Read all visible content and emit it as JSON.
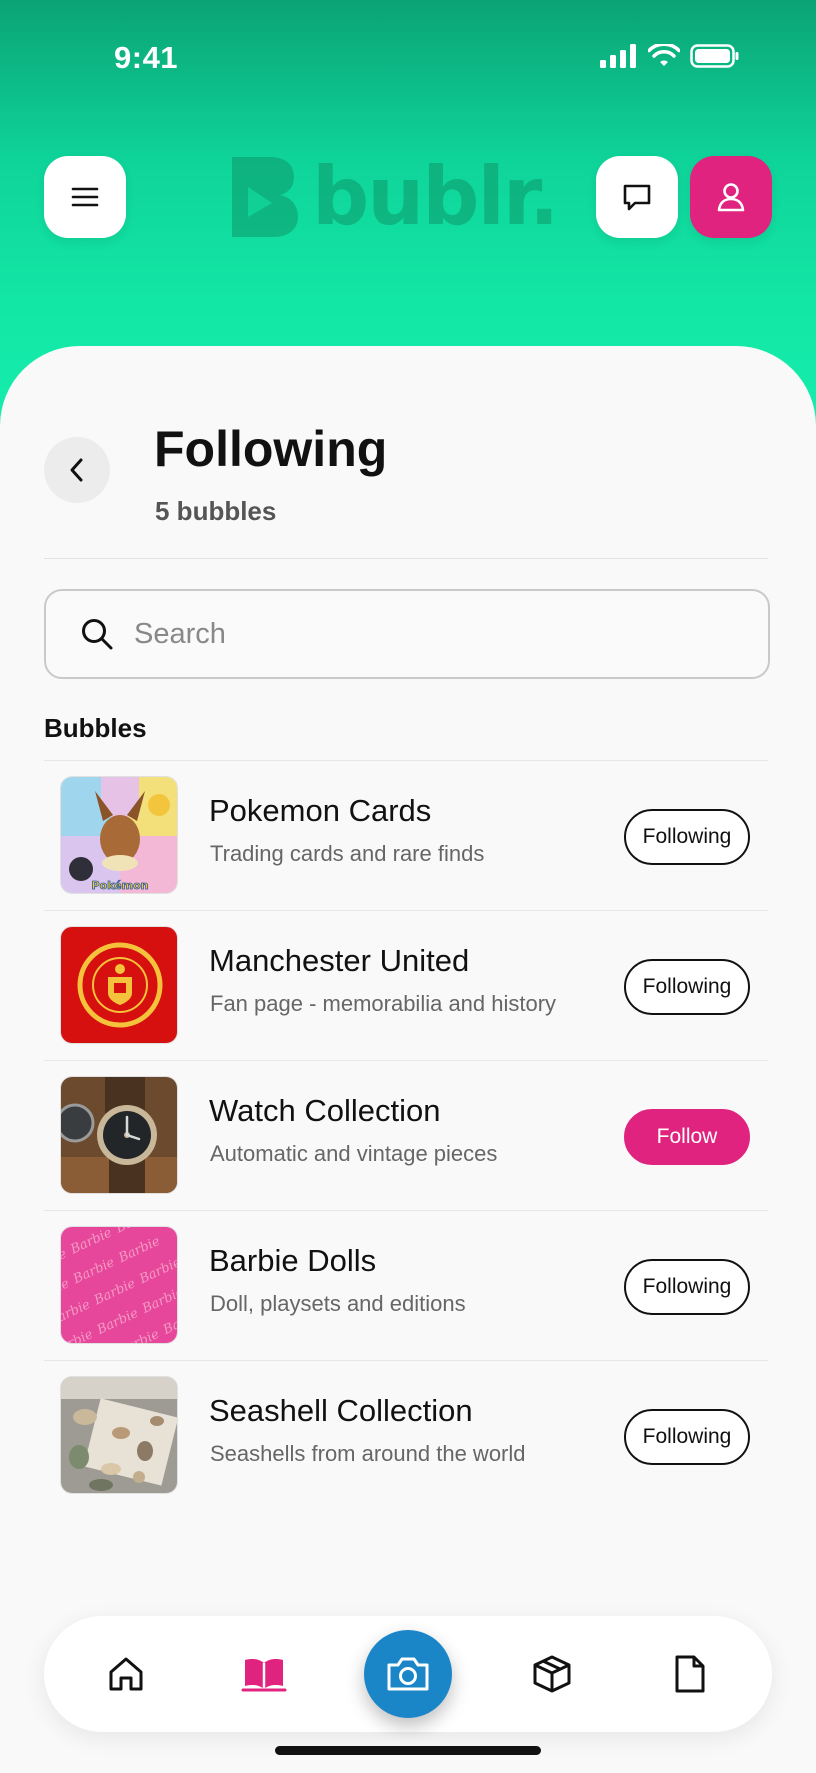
{
  "status_bar": {
    "time": "9:41"
  },
  "header": {
    "logo_text": "bublr."
  },
  "page": {
    "title": "Following",
    "subtitle": "5 bubbles"
  },
  "search": {
    "placeholder": "Search",
    "value": ""
  },
  "section_label": "Bubbles",
  "bubbles": [
    {
      "title": "Pokemon Cards",
      "description": "Trading cards and rare finds",
      "button": "Following",
      "following": true
    },
    {
      "title": "Manchester United",
      "description": "Fan page - memorabilia  and history",
      "button": "Following",
      "following": true
    },
    {
      "title": "Watch Collection",
      "description": "Automatic and vintage pieces",
      "button": "Follow",
      "following": false
    },
    {
      "title": "Barbie Dolls",
      "description": "Doll, playsets and editions",
      "button": "Following",
      "following": true
    },
    {
      "title": "Seashell Collection",
      "description": "Seashells from around the world",
      "button": "Following",
      "following": true
    }
  ],
  "thumbnail_text": {
    "crest": "MANCHESTER UNITED",
    "barbie": "Barbie"
  },
  "bottom_nav": [
    "home-icon",
    "book-icon",
    "camera-icon",
    "box-icon",
    "file-icon"
  ],
  "colors": {
    "accent": "#e0237f",
    "brand": "#13e8a6",
    "camera": "#1a86c7"
  }
}
